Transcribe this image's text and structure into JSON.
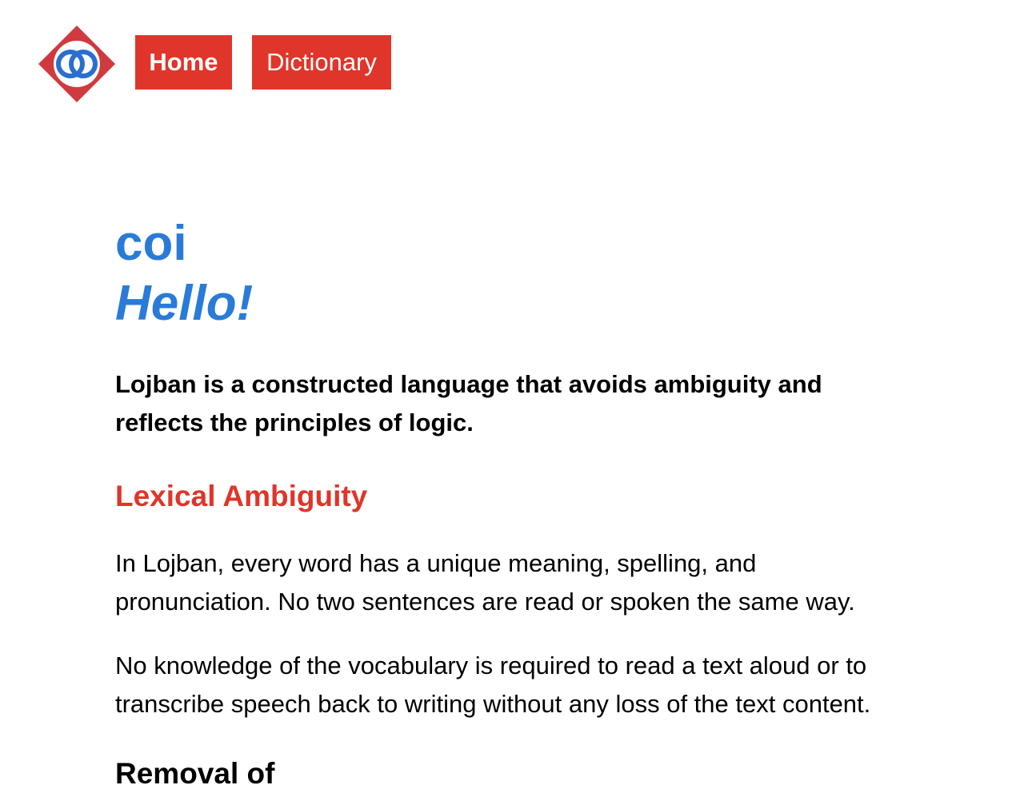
{
  "nav": {
    "logo_icon": "lojban-logo-icon",
    "home_label": "Home",
    "dictionary_label": "Dictionary"
  },
  "hero": {
    "word": "coi",
    "translation": "Hello!"
  },
  "intro": "Lojban is a constructed language that avoids ambiguity and reflects the principles of logic.",
  "sections": [
    {
      "heading": "Lexical Ambiguity",
      "paragraphs": [
        "In Lojban, every word has a unique meaning, spelling, and pronunciation. No two sentences are read or spoken the same way.",
        "No knowledge of the vocabulary is required to read a text aloud or to transcribe speech back to writing without any loss of the text content."
      ]
    },
    {
      "heading": "Removal of"
    }
  ],
  "colors": {
    "accent_red": "#e0352a",
    "accent_blue": "#2a7bd8"
  }
}
